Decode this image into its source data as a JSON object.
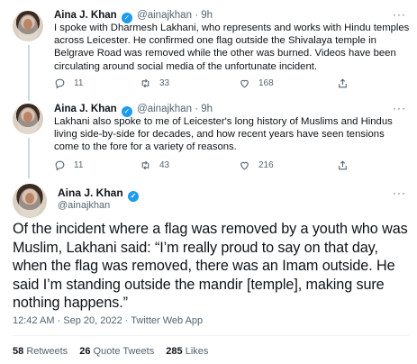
{
  "tweets": [
    {
      "name": "Aina J. Khan",
      "handle": "@ainajkhan",
      "dot": "·",
      "time": "9h",
      "text": "I spoke with Dharmesh Lakhani, who represents and works with Hindu temples across Leicester. He confirmed one flag outside the Shivalaya temple in Belgrave Road was removed while the other was burned. Videos have been circulating around social media of the unfortunate incident.",
      "replies": "11",
      "retweets": "33",
      "likes": "168"
    },
    {
      "name": "Aina J. Khan",
      "handle": "@ainajkhan",
      "dot": "·",
      "time": "9h",
      "text": "Lakhani also spoke to me of Leicester's long history of Muslims and Hindus living side-by-side for decades, and how recent years have seen tensions come to the fore for a variety of reasons.",
      "replies": "11",
      "retweets": "43",
      "likes": "216"
    }
  ],
  "main_tweet": {
    "name": "Aina J. Khan",
    "handle": "@ainajkhan",
    "text": "Of the incident where a flag was removed by a youth who was Muslim, Lakhani said: “I’m really proud to say on that day, when the flag was removed, there was an Imam outside. He said I’m standing outside the mandir [temple], making sure nothing happens.”",
    "meta": "12:42 AM · Sep 20, 2022 · Twitter Web App",
    "retweets_count": "58",
    "retweets_label": "Retweets",
    "quotes_count": "26",
    "quotes_label": "Quote Tweets",
    "likes_count": "285",
    "likes_label": "Likes"
  },
  "icons": {
    "more": "more-dots-icon",
    "reply": "reply-icon",
    "retweet": "retweet-icon",
    "like": "heart-icon",
    "share": "share-icon",
    "verified": "verified-badge-icon"
  },
  "colors": {
    "accent": "#1d9bf0",
    "secondary_text": "#536471",
    "primary_text": "#0f1419"
  }
}
